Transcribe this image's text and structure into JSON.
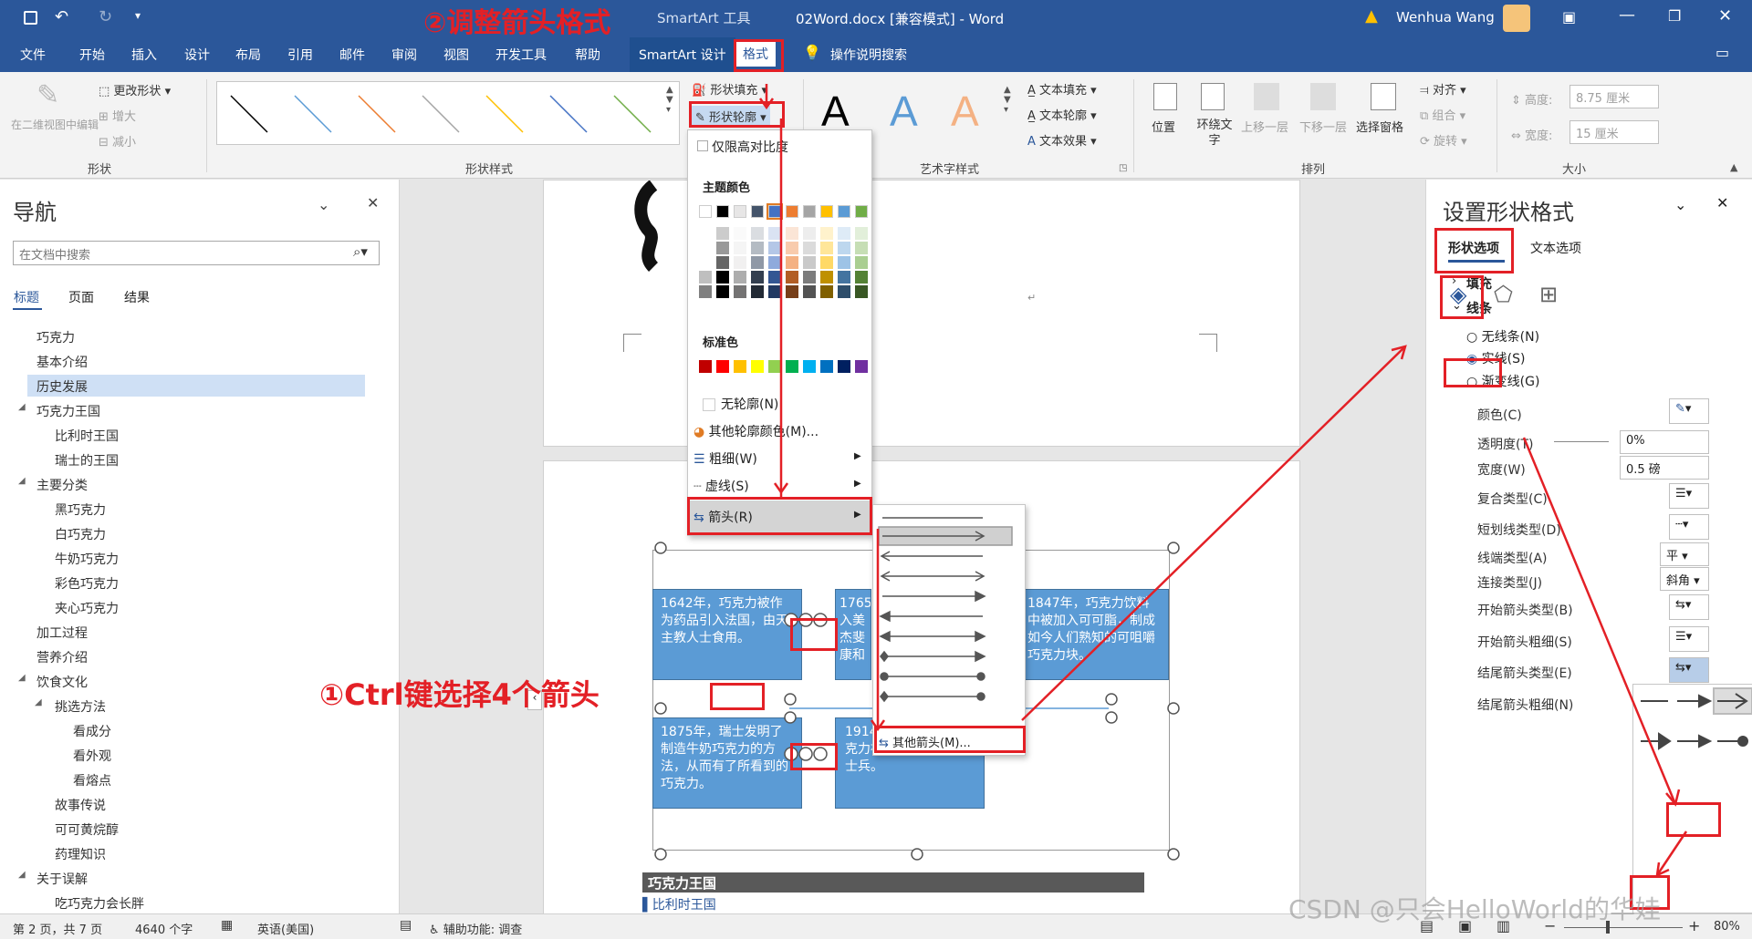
{
  "titlebar": {
    "context_tab": "SmartArt 工具",
    "doc_title": "02Word.docx [兼容模式] - Word",
    "user": "Wenhua Wang"
  },
  "tabs": [
    "文件",
    "开始",
    "插入",
    "设计",
    "布局",
    "引用",
    "邮件",
    "审阅",
    "视图",
    "开发工具",
    "帮助",
    "SmartArt 设计",
    "格式"
  ],
  "tell_me": "操作说明搜索",
  "ribbon": {
    "shape_group": {
      "label": "形状",
      "btn_3d": "在二维视图中编辑",
      "change_shape": "更改形状",
      "bigger": "增大",
      "smaller": "减小"
    },
    "shape_styles": {
      "label": "形状样式",
      "fill": "形状填充",
      "outline": "形状轮廓"
    },
    "wordart": {
      "label": "艺术字样式",
      "letters": [
        "A",
        "A",
        "A"
      ],
      "text_fill": "文本填充",
      "text_outline": "文本轮廓",
      "text_effect": "文本效果"
    },
    "arrange": {
      "label": "排列",
      "position": "位置",
      "wrap": "环绕文字",
      "bring_forward": "上移一层",
      "send_backward": "下移一层",
      "selection_pane": "选择窗格",
      "align": "对齐",
      "group": "组合",
      "rotate": "旋转"
    },
    "size": {
      "label": "大小",
      "height_label": "高度:",
      "height": "8.75 厘米",
      "width_label": "宽度:",
      "width": "15 厘米"
    }
  },
  "nav": {
    "title": "导航",
    "search_placeholder": "在文档中搜索",
    "tabs": [
      "标题",
      "页面",
      "结果"
    ],
    "items": [
      {
        "t": "巧克力",
        "l": 0
      },
      {
        "t": "基本介绍",
        "l": 0
      },
      {
        "t": "历史发展",
        "l": 0,
        "sel": true
      },
      {
        "t": "巧克力王国",
        "l": 0,
        "tw": true
      },
      {
        "t": "比利时王国",
        "l": 1
      },
      {
        "t": "瑞士的王国",
        "l": 1
      },
      {
        "t": "主要分类",
        "l": 0,
        "tw": true
      },
      {
        "t": "黑巧克力",
        "l": 1
      },
      {
        "t": "白巧克力",
        "l": 1
      },
      {
        "t": "牛奶巧克力",
        "l": 1
      },
      {
        "t": "彩色巧克力",
        "l": 1
      },
      {
        "t": "夹心巧克力",
        "l": 1
      },
      {
        "t": "加工过程",
        "l": 0
      },
      {
        "t": "营养介绍",
        "l": 0
      },
      {
        "t": "饮食文化",
        "l": 0,
        "tw": true
      },
      {
        "t": "挑选方法",
        "l": 1,
        "tw": true
      },
      {
        "t": "看成分",
        "l": 2
      },
      {
        "t": "看外观",
        "l": 2
      },
      {
        "t": "看熔点",
        "l": 2
      },
      {
        "t": "故事传说",
        "l": 1
      },
      {
        "t": "可可黄烷醇",
        "l": 1
      },
      {
        "t": "药理知识",
        "l": 1
      },
      {
        "t": "关于误解",
        "l": 0,
        "tw": true
      },
      {
        "t": "吃巧克力会长胖",
        "l": 1
      }
    ]
  },
  "outline_menu": {
    "high_contrast": "仅限高对比度",
    "theme_colors": "主题颜色",
    "standard_colors": "标准色",
    "no_outline": "无轮廓(N)",
    "more_colors": "其他轮廓颜色(M)...",
    "weight": "粗细(W)",
    "dashes": "虚线(S)",
    "arrows": "箭头(R)",
    "more_arrows": "其他箭头(M)..."
  },
  "theme_top": [
    "#ffffff",
    "#000000",
    "#e7e6e6",
    "#44546a",
    "#4472c4",
    "#ed7d31",
    "#a5a5a5",
    "#ffc000",
    "#5b9bd5",
    "#70ad47"
  ],
  "standard_colors": [
    "#c00000",
    "#ff0000",
    "#ffc000",
    "#ffff00",
    "#92d050",
    "#00b050",
    "#00b0f0",
    "#0070c0",
    "#002060",
    "#7030a0"
  ],
  "smartart": {
    "box1": "1642年，巧克力被作为药品引入法国，由天主教人士食用。",
    "box2": "1765入美杰斐康和",
    "box3": "1847年，巧克力饮料中被加入可可脂，制成如今人们熟知的可咀嚼巧克力块。",
    "box4": "1875年，瑞士发明了制造牛奶巧克力的方法，从而有了所看到的巧克力。",
    "box5": "1914界大的生产，巧克力被运到战场分发给士兵。"
  },
  "doc_text": {
    "heading": "巧克力王国",
    "sub": "比利时王国"
  },
  "pane": {
    "title": "设置形状格式",
    "tab_shape": "形状选项",
    "tab_text": "文本选项",
    "fill": "填充",
    "line": "线条",
    "no_line": "无线条(N)",
    "solid": "实线(S)",
    "gradient": "渐变线(G)",
    "color": "颜色(C)",
    "transparency": "透明度(T)",
    "transparency_val": "0%",
    "width": "宽度(W)",
    "width_val": "0.5 磅",
    "compound": "复合类型(C)",
    "dash": "短划线类型(D)",
    "cap": "线端类型(A)",
    "cap_val": "平",
    "join": "连接类型(J)",
    "join_val": "斜角",
    "begin_type": "开始箭头类型(B)",
    "begin_size": "开始箭头粗细(S)",
    "end_type": "结尾箭头类型(E)",
    "end_size": "结尾箭头粗细(N)"
  },
  "status": {
    "page": "第 2 页，共 7 页",
    "words": "4640 个字",
    "lang": "英语(美国)",
    "access": "辅助功能: 调查",
    "zoom": "80%"
  },
  "annotations": {
    "step1": "①Ctrl键选择4个箭头",
    "step2": "②调整箭头格式",
    "watermark": "CSDN @只会HelloWorld的华娃"
  }
}
